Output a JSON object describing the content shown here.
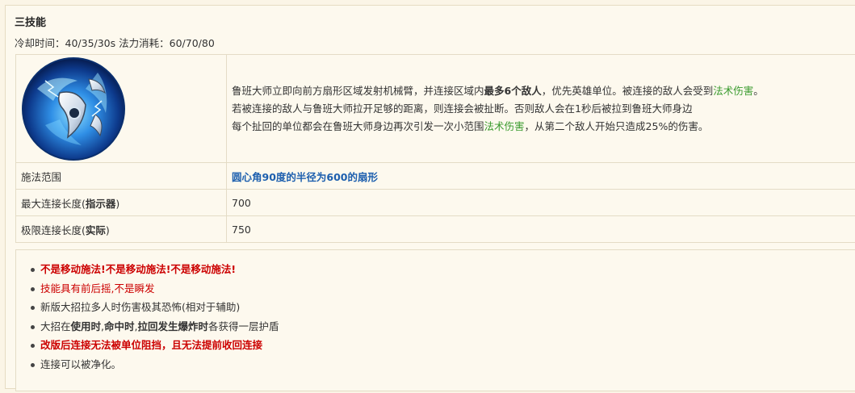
{
  "skill": {
    "title": "三技能",
    "meta": "冷却时间：40/35/30s  法力消耗：60/70/80",
    "icon": "skill-mechanical-arm-icon"
  },
  "description": {
    "line1": [
      {
        "text": "鲁班大师立即向前方扇形区域发射机械臂，并连接区域内",
        "style": "normal"
      },
      {
        "text": "最多6个敌人",
        "style": "bold"
      },
      {
        "text": "，优先英雄单位。被连接的敌人会受到",
        "style": "normal"
      },
      {
        "text": "法术伤害",
        "style": "green"
      },
      {
        "text": "。",
        "style": "normal"
      }
    ],
    "line2": "若被连接的敌人与鲁班大师拉开足够的距离，则连接会被扯断。否则敌人会在1秒后被拉到鲁班大师身边",
    "line3": [
      {
        "text": "每个扯回的单位都会在鲁班大师身边再次引发一次小范围",
        "style": "normal"
      },
      {
        "text": "法术伤害",
        "style": "green"
      },
      {
        "text": "，从第二个敌人开始只造成25%的伤害。",
        "style": "normal"
      }
    ]
  },
  "rows": [
    {
      "label": "施法范围",
      "label_bold": "",
      "label_suffix": "",
      "value": "圆心角90度的半径为600的扇形",
      "value_style": "blue"
    },
    {
      "label": "最大连接长度(",
      "label_bold": "指示器",
      "label_suffix": ")",
      "value": "700",
      "value_style": "normal"
    },
    {
      "label": "极限连接长度(",
      "label_bold": "实际",
      "label_suffix": ")",
      "value": "750",
      "value_style": "normal"
    }
  ],
  "notes": [
    [
      {
        "text": "不是移动施法!不是移动施法!不是移动施法!",
        "style": "redb"
      }
    ],
    [
      {
        "text": "技能具有前后摇,不是瞬发",
        "style": "red"
      }
    ],
    [
      {
        "text": "新版大招拉多人时伤害极其恐怖(相对于辅助)",
        "style": "normal"
      }
    ],
    [
      {
        "text": "大招在",
        "style": "normal"
      },
      {
        "text": "使用时",
        "style": "bold"
      },
      {
        "text": ",",
        "style": "normal"
      },
      {
        "text": "命中时",
        "style": "bold"
      },
      {
        "text": ",",
        "style": "normal"
      },
      {
        "text": "拉回发生爆炸时",
        "style": "bold"
      },
      {
        "text": "各获得一层护盾",
        "style": "normal"
      }
    ],
    [
      {
        "text": "改版后连接无法被单位阻挡，且无法提前收回连接",
        "style": "redb"
      }
    ],
    [
      {
        "text": "连接可以被净化。",
        "style": "normal"
      }
    ]
  ]
}
